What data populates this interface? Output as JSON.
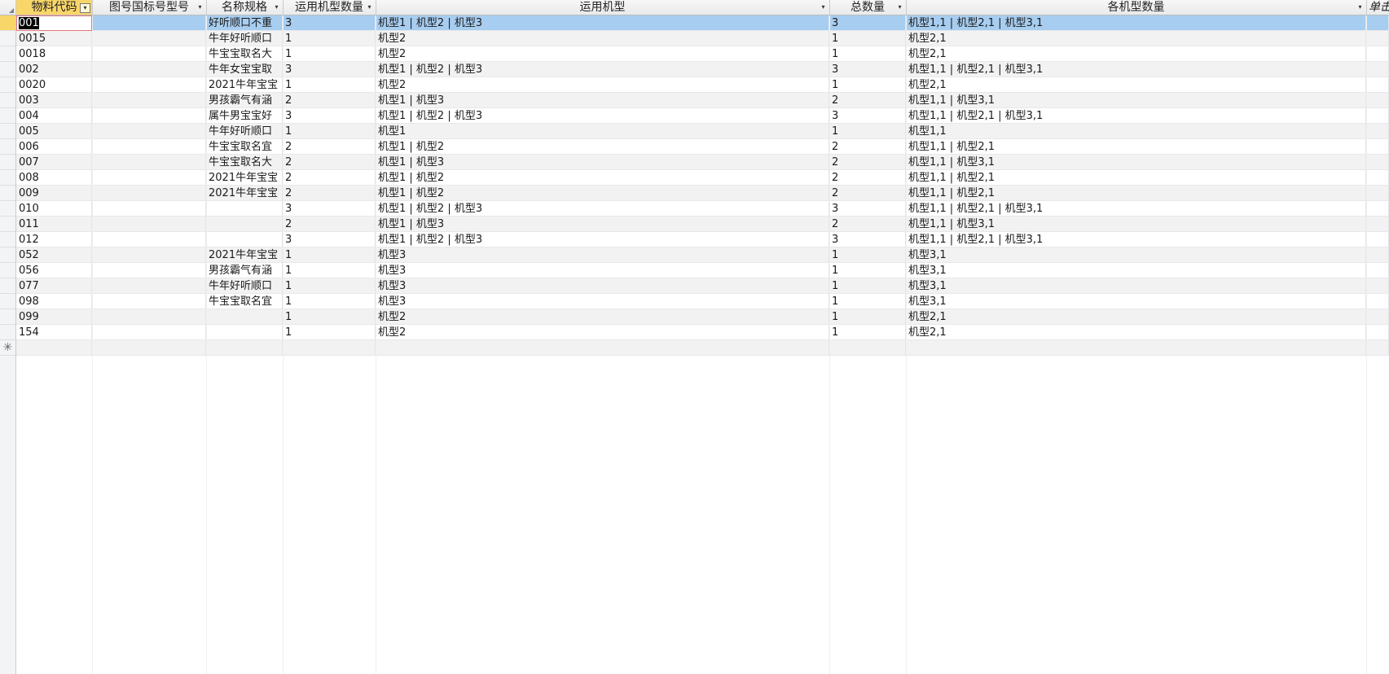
{
  "columns": [
    {
      "key": "code",
      "label": "物料代码",
      "filtered": true
    },
    {
      "key": "drawing",
      "label": "图号国标号型号",
      "filtered": false
    },
    {
      "key": "spec",
      "label": "名称规格",
      "filtered": false
    },
    {
      "key": "model_count",
      "label": "运用机型数量",
      "filtered": false
    },
    {
      "key": "models",
      "label": "运用机型",
      "filtered": false
    },
    {
      "key": "total",
      "label": "总数量",
      "filtered": false
    },
    {
      "key": "per_model",
      "label": "各机型数量",
      "filtered": false
    },
    {
      "key": "unit",
      "label": "单击",
      "filtered": false
    }
  ],
  "dropdown_glyph": "▾",
  "new_row_glyph": "✳",
  "rows": [
    {
      "code": "001",
      "drawing": "",
      "spec": "好听顺口不重",
      "model_count": "3",
      "models": "机型1 | 机型2 | 机型3",
      "total": "3",
      "per_model": "机型1,1 | 机型2,1 | 机型3,1"
    },
    {
      "code": "0015",
      "drawing": "",
      "spec": "牛年好听顺口",
      "model_count": "1",
      "models": "机型2",
      "total": "1",
      "per_model": "机型2,1"
    },
    {
      "code": "0018",
      "drawing": "",
      "spec": "牛宝宝取名大",
      "model_count": "1",
      "models": "机型2",
      "total": "1",
      "per_model": "机型2,1"
    },
    {
      "code": "002",
      "drawing": "",
      "spec": "牛年女宝宝取",
      "model_count": "3",
      "models": "机型1 | 机型2 | 机型3",
      "total": "3",
      "per_model": "机型1,1 | 机型2,1 | 机型3,1"
    },
    {
      "code": "0020",
      "drawing": "",
      "spec": "2021牛年宝宝",
      "model_count": "1",
      "models": "机型2",
      "total": "1",
      "per_model": "机型2,1"
    },
    {
      "code": "003",
      "drawing": "",
      "spec": "男孩霸气有涵",
      "model_count": "2",
      "models": "机型1 | 机型3",
      "total": "2",
      "per_model": "机型1,1 | 机型3,1"
    },
    {
      "code": "004",
      "drawing": "",
      "spec": "属牛男宝宝好",
      "model_count": "3",
      "models": "机型1 | 机型2 | 机型3",
      "total": "3",
      "per_model": "机型1,1 | 机型2,1 | 机型3,1"
    },
    {
      "code": "005",
      "drawing": "",
      "spec": "牛年好听顺口",
      "model_count": "1",
      "models": "机型1",
      "total": "1",
      "per_model": "机型1,1"
    },
    {
      "code": "006",
      "drawing": "",
      "spec": "牛宝宝取名宜",
      "model_count": "2",
      "models": "机型1 | 机型2",
      "total": "2",
      "per_model": "机型1,1 | 机型2,1"
    },
    {
      "code": "007",
      "drawing": "",
      "spec": "牛宝宝取名大",
      "model_count": "2",
      "models": "机型1 | 机型3",
      "total": "2",
      "per_model": "机型1,1 | 机型3,1"
    },
    {
      "code": "008",
      "drawing": "",
      "spec": "2021牛年宝宝",
      "model_count": "2",
      "models": "机型1 | 机型2",
      "total": "2",
      "per_model": "机型1,1 | 机型2,1"
    },
    {
      "code": "009",
      "drawing": "",
      "spec": "2021牛年宝宝",
      "model_count": "2",
      "models": "机型1 | 机型2",
      "total": "2",
      "per_model": "机型1,1 | 机型2,1"
    },
    {
      "code": "010",
      "drawing": "",
      "spec": "",
      "model_count": "3",
      "models": "机型1 | 机型2 | 机型3",
      "total": "3",
      "per_model": "机型1,1 | 机型2,1 | 机型3,1"
    },
    {
      "code": "011",
      "drawing": "",
      "spec": "",
      "model_count": "2",
      "models": "机型1 | 机型3",
      "total": "2",
      "per_model": "机型1,1 | 机型3,1"
    },
    {
      "code": "012",
      "drawing": "",
      "spec": "",
      "model_count": "3",
      "models": "机型1 | 机型2 | 机型3",
      "total": "3",
      "per_model": "机型1,1 | 机型2,1 | 机型3,1"
    },
    {
      "code": "052",
      "drawing": "",
      "spec": "2021牛年宝宝",
      "model_count": "1",
      "models": "机型3",
      "total": "1",
      "per_model": "机型3,1"
    },
    {
      "code": "056",
      "drawing": "",
      "spec": "男孩霸气有涵",
      "model_count": "1",
      "models": "机型3",
      "total": "1",
      "per_model": "机型3,1"
    },
    {
      "code": "077",
      "drawing": "",
      "spec": "牛年好听顺口",
      "model_count": "1",
      "models": "机型3",
      "total": "1",
      "per_model": "机型3,1"
    },
    {
      "code": "098",
      "drawing": "",
      "spec": "牛宝宝取名宜",
      "model_count": "1",
      "models": "机型3",
      "total": "1",
      "per_model": "机型3,1"
    },
    {
      "code": "099",
      "drawing": "",
      "spec": "",
      "model_count": "1",
      "models": "机型2",
      "total": "1",
      "per_model": "机型2,1"
    },
    {
      "code": "154",
      "drawing": "",
      "spec": "",
      "model_count": "1",
      "models": "机型2",
      "total": "1",
      "per_model": "机型2,1"
    }
  ],
  "selected_row": 0
}
